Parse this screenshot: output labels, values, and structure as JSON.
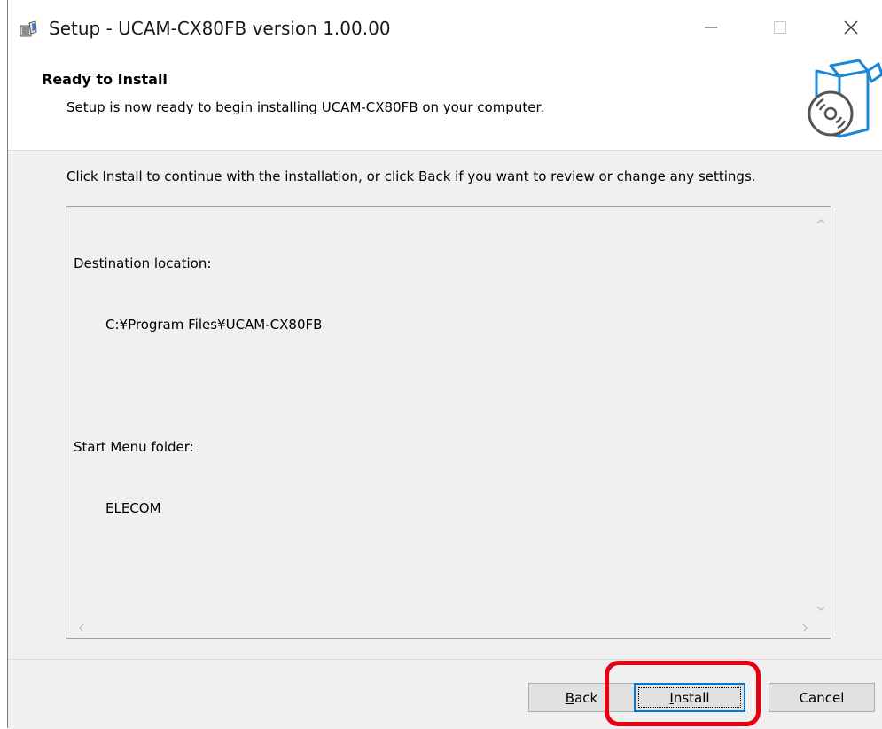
{
  "window": {
    "title": "Setup - UCAM-CX80FB version 1.00.00",
    "icon": "setup-package-icon",
    "controls": {
      "minimize_icon": "minimize-icon",
      "maximize_icon": "maximize-icon",
      "close_icon": "close-icon"
    }
  },
  "header": {
    "title": "Ready to Install",
    "subtitle": "Setup is now ready to begin installing UCAM-CX80FB on your computer.",
    "art_icon": "install-box-disc-icon"
  },
  "content": {
    "instruction": "Click Install to continue with the installation, or click Back if you want to review or change any settings.",
    "memo": {
      "destination_label": "Destination location:",
      "destination_value": "C:¥Program Files¥UCAM-CX80FB",
      "start_menu_label": "Start Menu folder:",
      "start_menu_value": "ELECOM"
    }
  },
  "footer": {
    "back_label": "Back",
    "install_label": "Install",
    "cancel_label": "Cancel"
  },
  "colors": {
    "highlight": "#e8000f",
    "focus_border": "#0078d7",
    "panel_bg": "#f0f0f0"
  }
}
